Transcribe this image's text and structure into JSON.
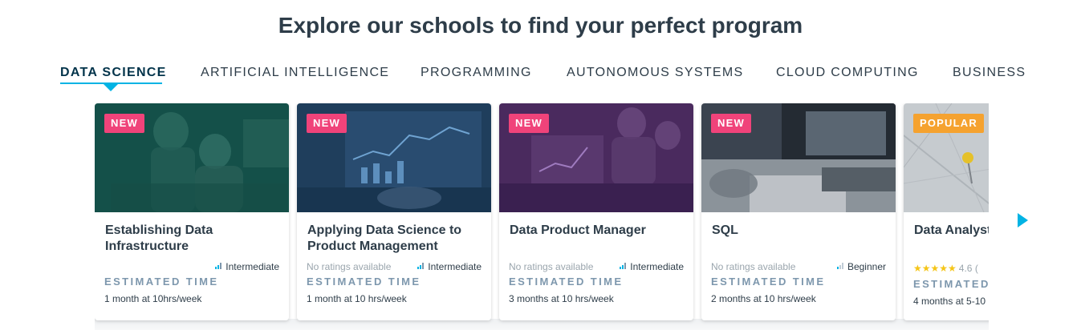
{
  "heading": "Explore our schools to find your perfect program",
  "tabs": [
    {
      "label": "DATA SCIENCE",
      "active": true
    },
    {
      "label": "ARTIFICIAL INTELLIGENCE",
      "active": false
    },
    {
      "label": "PROGRAMMING",
      "active": false
    },
    {
      "label": "AUTONOMOUS SYSTEMS",
      "active": false
    },
    {
      "label": "CLOUD COMPUTING",
      "active": false
    },
    {
      "label": "BUSINESS",
      "active": false
    }
  ],
  "colors": {
    "accent": "#02b3e4",
    "badge_new": "#f0437a",
    "badge_popular": "#f5a22f",
    "text_dark": "#2e3d49",
    "estimated_label": "#7d97ad"
  },
  "cards": [
    {
      "badge": "NEW",
      "title": "Establishing Data Infrastructure",
      "ratings": "",
      "level": "Intermediate",
      "estimated_label": "ESTIMATED TIME",
      "estimated_value": "1 month at 10hrs/week"
    },
    {
      "badge": "NEW",
      "title": "Applying Data Science to Product Management",
      "ratings": "No ratings available",
      "level": "Intermediate",
      "estimated_label": "ESTIMATED TIME",
      "estimated_value": "1 month at 10 hrs/week"
    },
    {
      "badge": "NEW",
      "title": "Data Product Manager",
      "ratings": "No ratings available",
      "level": "Intermediate",
      "estimated_label": "ESTIMATED TIME",
      "estimated_value": "3 months at 10 hrs/week"
    },
    {
      "badge": "NEW",
      "title": "SQL",
      "ratings": "No ratings available",
      "level": "Beginner",
      "estimated_label": "ESTIMATED TIME",
      "estimated_value": "2 months at 10 hrs/week"
    },
    {
      "badge": "POPULAR",
      "title": "Data Analyst",
      "stars": "★★★★★",
      "rating": "4.6 (",
      "estimated_label": "ESTIMATED",
      "estimated_value": "4 months at 5-10"
    }
  ],
  "icons": {
    "level": "signal-bars-icon",
    "next": "carousel-next-arrow-icon"
  }
}
